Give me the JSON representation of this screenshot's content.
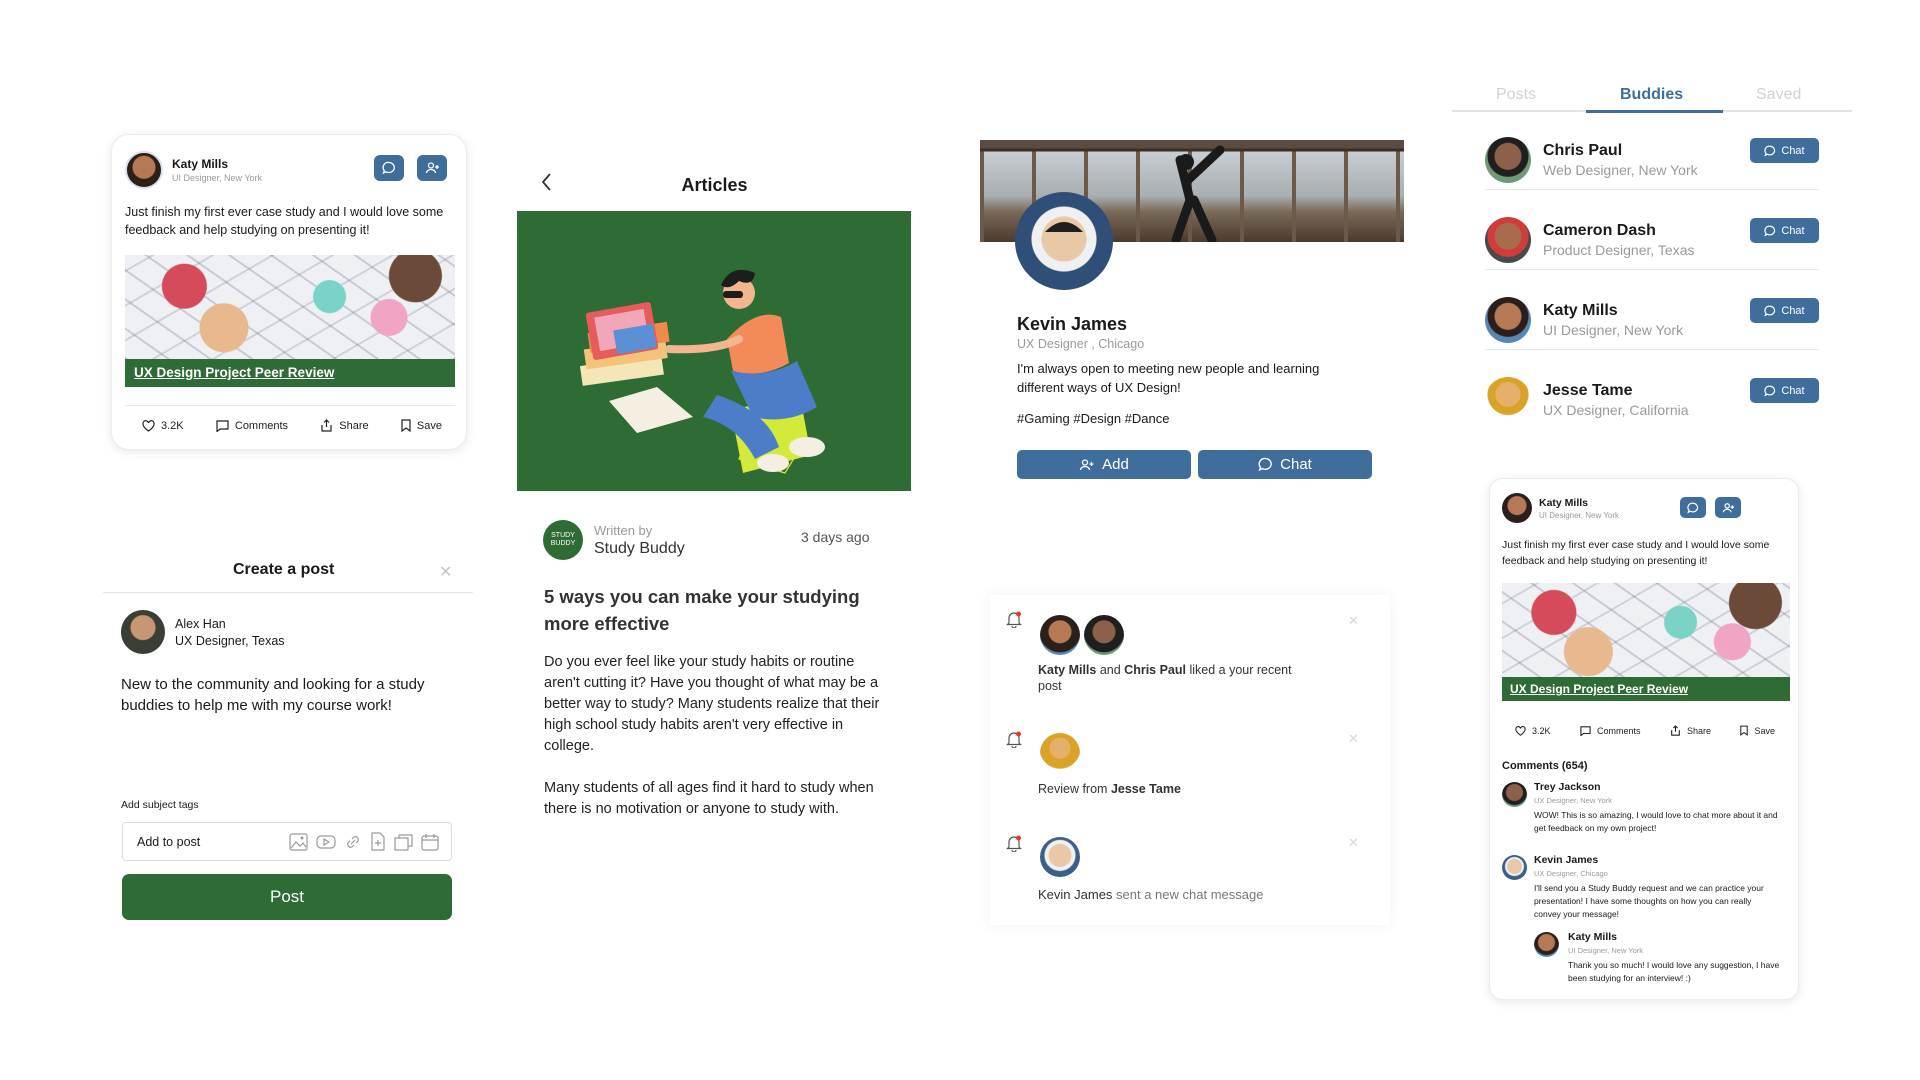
{
  "post_card": {
    "author": "Katy Mills",
    "role": "UI Designer, New York",
    "text": "Just finish my first ever case study and I would love some feedback and help studying on presenting it!",
    "image_caption": "UX Design Project Peer Review",
    "likes": "3.2K",
    "comments_label": "Comments",
    "share_label": "Share",
    "save_label": "Save"
  },
  "create_post": {
    "title": "Create a post",
    "author": "Alex Han",
    "role": "UX Designer, Texas",
    "text": "New to the community and looking for a study buddies to help me with my course work!",
    "tags_label": "Add subject tags",
    "input_placeholder": "Add to post",
    "post_button": "Post"
  },
  "article": {
    "header": "Articles",
    "written_by_label": "Written by",
    "author": "Study Buddy",
    "logo_text": "STUDY BUDDY",
    "time": "3 days ago",
    "title": "5 ways you can make your studying more effective",
    "para1": "Do you ever feel like your study habits or routine aren't cutting it? Have you thought of what may be a better way to study? Many students realize that their high school study habits aren't very effective in college.",
    "para2": "Many students of all ages find it hard to study when there is no motivation or anyone to study with."
  },
  "profile": {
    "name": "Kevin James",
    "role": "UX Designer , Chicago",
    "bio": "I'm always open to meeting new people and learning different ways of UX Design!",
    "tags": "#Gaming #Design #Dance",
    "add_button": "Add",
    "chat_button": "Chat"
  },
  "notifications": [
    {
      "name1": "Katy Mills",
      "mid": " and ",
      "name2": "Chris Paul",
      "text": " liked a your recent post"
    },
    {
      "prefix": "Review from ",
      "name": "Jesse Tame"
    },
    {
      "name": "Kevin James",
      "text": " sent a new chat message"
    }
  ],
  "buddies": {
    "tabs": [
      "Posts",
      "Buddies",
      "Saved"
    ],
    "chat_label": "Chat",
    "list": [
      {
        "name": "Chris Paul",
        "role": "Web Designer, New York"
      },
      {
        "name": "Cameron Dash",
        "role": "Product Designer, Texas"
      },
      {
        "name": "Katy Mills",
        "role": "UI Designer, New York"
      },
      {
        "name": "Jesse Tame",
        "role": "UX Designer, California"
      }
    ]
  },
  "post_detail": {
    "author": "Katy Mills",
    "role": "UI Designer, New York",
    "text": "Just finish my first ever case study and I would love some feedback and help studying on presenting it!",
    "image_caption": "UX Design Project Peer Review",
    "likes": "3.2K",
    "comments_label": "Comments",
    "share_label": "Share",
    "save_label": "Save",
    "comments_header": "Comments (654)",
    "comments": [
      {
        "name": "Trey Jackson",
        "role": "UX Designer, New York",
        "text": "WOW! This is so amazing, I would love to chat more about it and get feedback on my own project!"
      },
      {
        "name": "Kevin James",
        "role": "UX Designer, Chicago",
        "text": "I'll send you a Study Buddy request and we can practice your presentation! I have some thoughts on how you can really convey your message!"
      },
      {
        "name": "Katy Mills",
        "role": "UI Designer, New York",
        "text": "Thank you so much! I would love any suggestion, I have been studying for an interview! :)"
      }
    ]
  },
  "colors": {
    "accent_blue": "#3f6e9c",
    "accent_green": "#2e6b35",
    "bell_red": "#e53935"
  }
}
